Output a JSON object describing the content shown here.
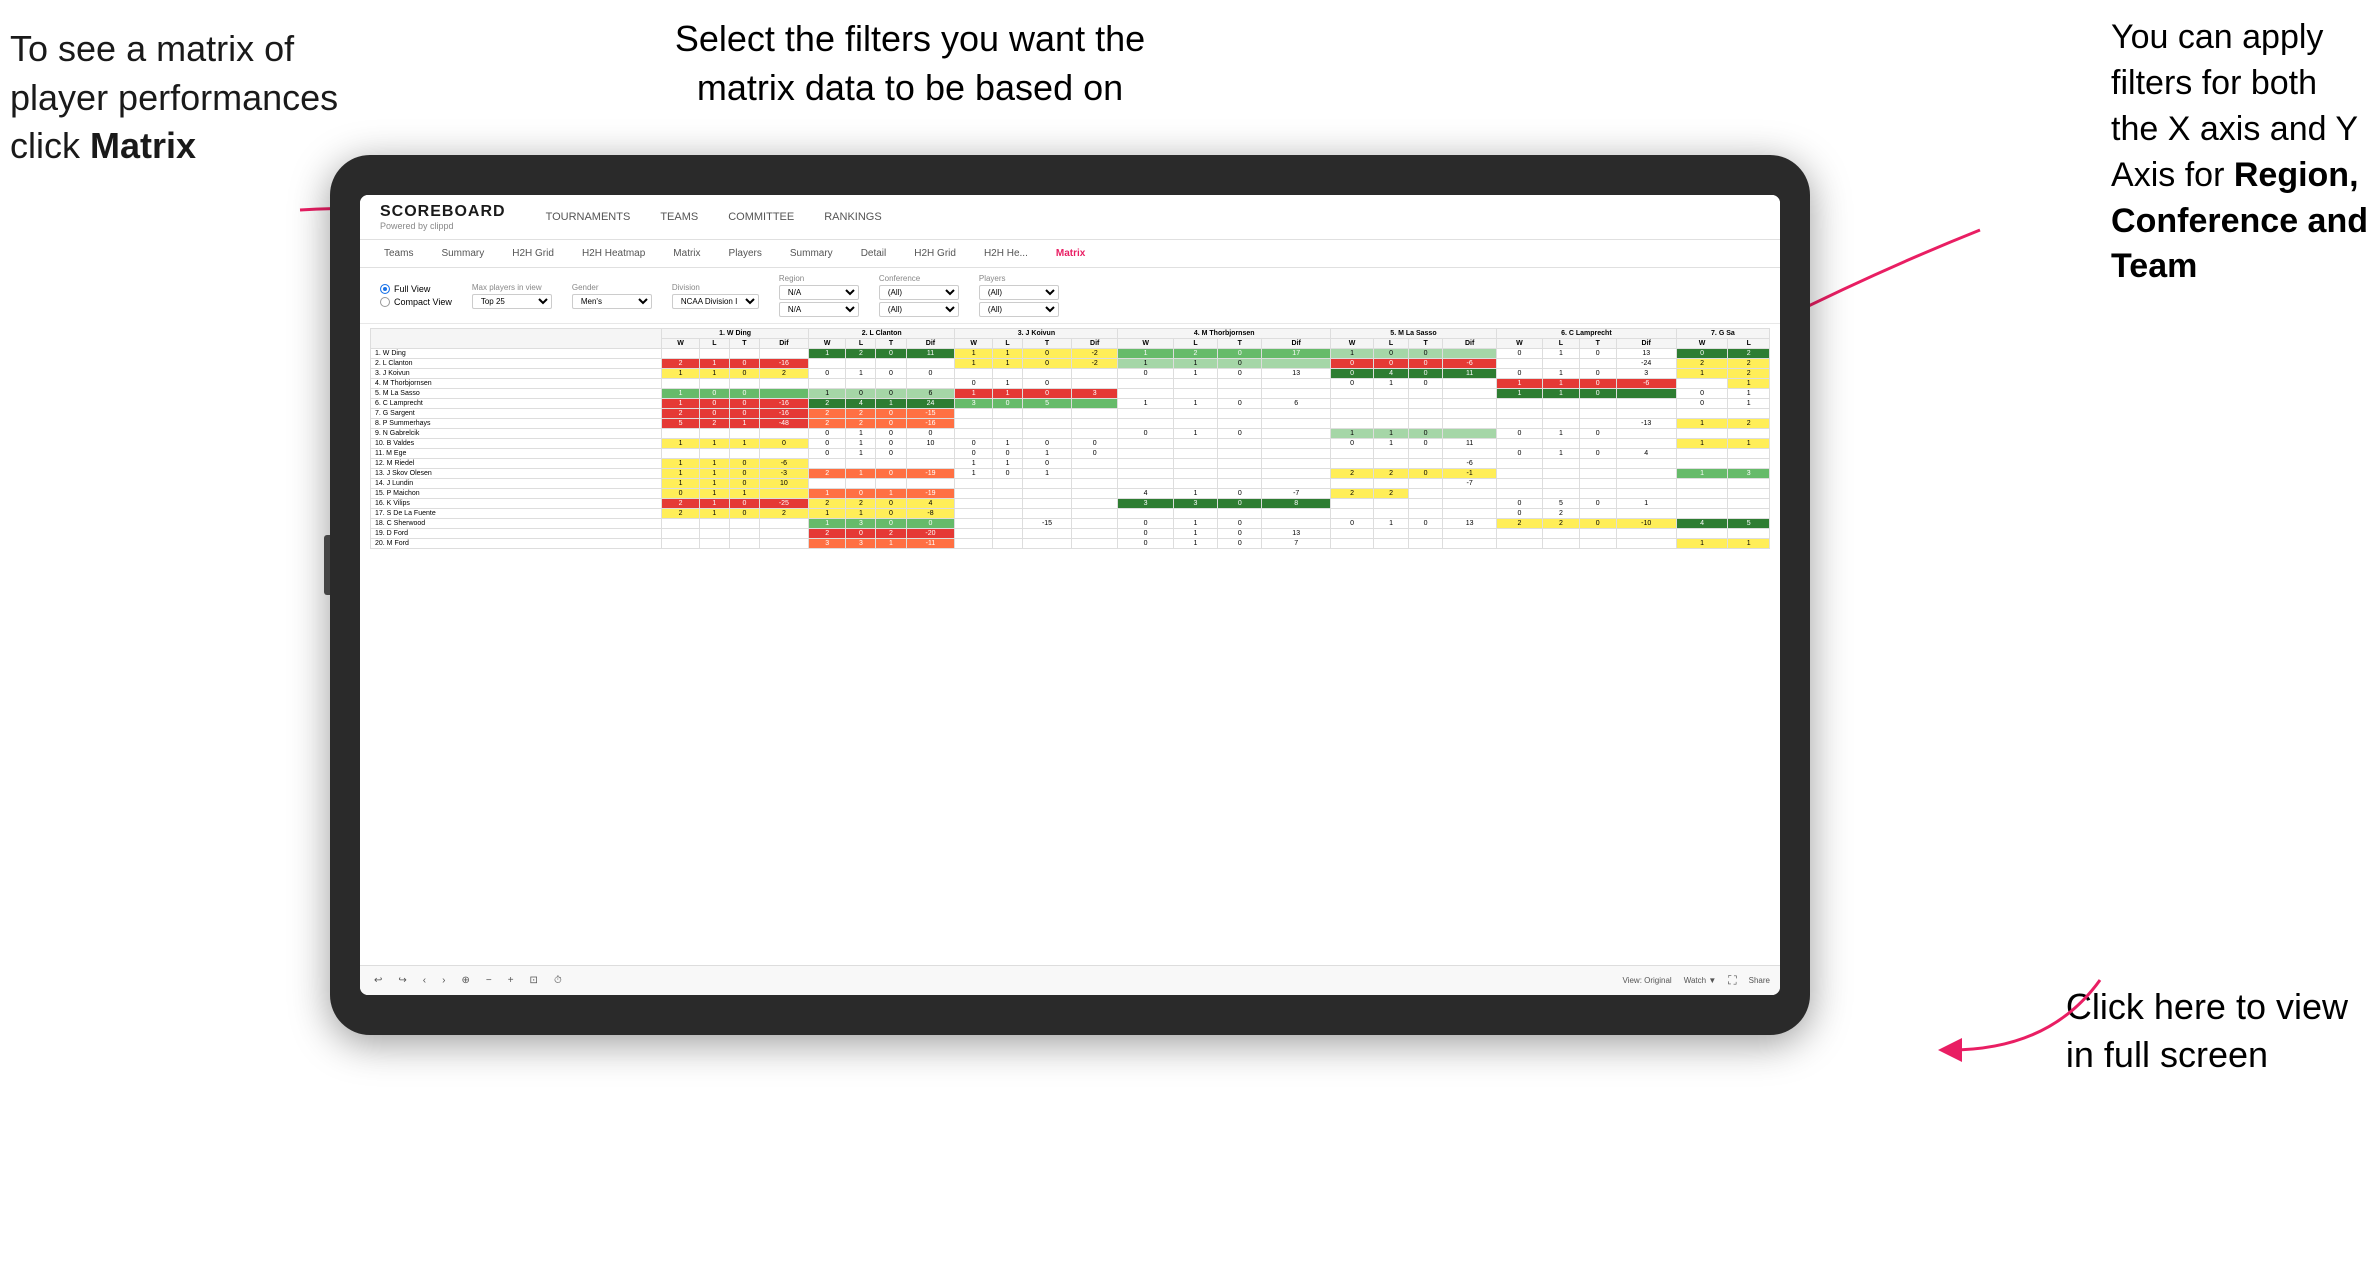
{
  "annotations": {
    "top_left": {
      "line1": "To see a matrix of",
      "line2": "player performances",
      "line3_plain": "click ",
      "line3_bold": "Matrix"
    },
    "top_center": {
      "text": "Select the filters you want the\nmatrix data to be based on"
    },
    "top_right": {
      "line1": "You  can apply",
      "line2": "filters for both",
      "line3": "the X axis and Y",
      "line4_plain": "Axis for ",
      "line4_bold": "Region,",
      "line5_bold": "Conference and",
      "line6_bold": "Team"
    },
    "bottom_right": {
      "line1": "Click here to view",
      "line2": "in full screen"
    }
  },
  "app": {
    "logo": "SCOREBOARD",
    "logo_sub": "Powered by clippd",
    "nav": [
      "TOURNAMENTS",
      "TEAMS",
      "COMMITTEE",
      "RANKINGS"
    ],
    "sub_nav": [
      "Teams",
      "Summary",
      "H2H Grid",
      "H2H Heatmap",
      "Matrix",
      "Players",
      "Summary",
      "Detail",
      "H2H Grid",
      "H2H He...",
      "Matrix"
    ],
    "active_tab": "Matrix",
    "filters": {
      "view_options": [
        "Full View",
        "Compact View"
      ],
      "selected_view": "Full View",
      "max_players_label": "Max players in view",
      "max_players_value": "Top 25",
      "gender_label": "Gender",
      "gender_value": "Men's",
      "division_label": "Division",
      "division_value": "NCAA Division I",
      "region_label": "Region",
      "region_value": "N/A",
      "conference_label": "Conference",
      "conference_value": "(All)",
      "players_label": "Players",
      "players_value": "(All)"
    },
    "matrix": {
      "col_headers": [
        "1. W Ding",
        "2. L Clanton",
        "3. J Koivun",
        "4. M Thorbjornsen",
        "5. M La Sasso",
        "6. C Lamprecht",
        "7. G Sa"
      ],
      "sub_headers": [
        "W",
        "L",
        "T",
        "Dif"
      ],
      "rows": [
        {
          "name": "1. W Ding",
          "cells": [
            "",
            "",
            "",
            "",
            "1",
            "2",
            "0",
            "11",
            "1",
            "1",
            "0",
            "-2",
            "1",
            "2",
            "0",
            "17",
            "1",
            "0",
            "0",
            "",
            "0",
            "1",
            "0",
            "13",
            "0",
            "2"
          ]
        },
        {
          "name": "2. L Clanton",
          "cells": [
            "2",
            "1",
            "0",
            "-16",
            "",
            "",
            "",
            "",
            "1",
            "1",
            "0",
            "-2",
            "1",
            "1",
            "0",
            "",
            "0",
            "0",
            "0",
            "-6",
            "",
            "",
            "",
            "",
            "-24",
            "2",
            "2"
          ]
        },
        {
          "name": "3. J Koivun",
          "cells": [
            "1",
            "1",
            "0",
            "2",
            "0",
            "1",
            "0",
            "0",
            "",
            "",
            "",
            "",
            "0",
            "1",
            "0",
            "13",
            "0",
            "4",
            "0",
            "11",
            "0",
            "1",
            "0",
            "3",
            "1",
            "2"
          ]
        },
        {
          "name": "4. M Thorbjornsen",
          "cells": [
            "",
            "",
            "",
            "",
            "",
            "",
            "",
            "",
            "0",
            "1",
            "0",
            "",
            "",
            "",
            "",
            "",
            "0",
            "1",
            "0",
            "",
            "1",
            "1",
            "0",
            "-6",
            "",
            "",
            "",
            "1"
          ]
        },
        {
          "name": "5. M La Sasso",
          "cells": [
            "1",
            "0",
            "0",
            "",
            "1",
            "0",
            "0",
            "6",
            "1",
            "1",
            "0",
            "3",
            "",
            "",
            "",
            "",
            "1",
            "1",
            "0",
            "",
            "",
            "",
            "",
            "",
            "0",
            "1"
          ]
        },
        {
          "name": "6. C Lamprecht",
          "cells": [
            "1",
            "0",
            "0",
            "-16",
            "2",
            "4",
            "1",
            "24",
            "3",
            "0",
            "5",
            "",
            "1",
            "1",
            "0",
            "6",
            "",
            "",
            "",
            "",
            "",
            "",
            "",
            "",
            "0",
            "1"
          ]
        },
        {
          "name": "7. G Sargent",
          "cells": [
            "2",
            "0",
            "0",
            "-16",
            "2",
            "2",
            "0",
            "-15",
            "",
            "",
            "",
            "",
            "",
            "",
            "",
            "",
            "",
            "",
            "",
            "",
            "",
            "",
            "",
            "",
            "",
            ""
          ]
        },
        {
          "name": "8. P Summerhays",
          "cells": [
            "5",
            "2",
            "1",
            "-48",
            "2",
            "2",
            "0",
            "-16",
            "",
            "",
            "",
            "",
            "",
            "",
            "",
            "",
            "",
            "",
            "",
            "",
            "",
            "",
            "",
            "-13",
            "1",
            "2"
          ]
        },
        {
          "name": "9. N Gabrelcik",
          "cells": [
            "",
            "",
            "",
            "",
            "0",
            "1",
            "0",
            "0",
            "",
            "",
            "",
            "",
            "0",
            "1",
            "0",
            "",
            "1",
            "1",
            "0",
            "",
            "0",
            "1",
            "0",
            "",
            "",
            ""
          ]
        },
        {
          "name": "10. B Valdes",
          "cells": [
            "1",
            "1",
            "1",
            "0",
            "0",
            "1",
            "0",
            "10",
            "0",
            "1",
            "0",
            "0",
            "",
            "",
            "",
            "",
            "0",
            "1",
            "0",
            "11",
            "",
            "",
            "",
            "",
            "1",
            "1"
          ]
        },
        {
          "name": "11. M Ege",
          "cells": [
            "",
            "",
            "",
            "",
            "0",
            "1",
            "0",
            "",
            "0",
            "0",
            "1",
            "0",
            "",
            "",
            "",
            "",
            "",
            "",
            "",
            "",
            "0",
            "1",
            "0",
            "4",
            "",
            ""
          ]
        },
        {
          "name": "12. M Riedel",
          "cells": [
            "1",
            "1",
            "0",
            "-6",
            "",
            "",
            "",
            "",
            "1",
            "1",
            "0",
            "",
            "",
            "",
            "",
            "",
            "",
            "",
            "",
            "",
            "-6",
            "",
            "",
            "",
            "",
            ""
          ]
        },
        {
          "name": "13. J Skov Olesen",
          "cells": [
            "1",
            "1",
            "0",
            "-3",
            "2",
            "1",
            "0",
            "-19",
            "1",
            "0",
            "1",
            "",
            "",
            "",
            "",
            "",
            "2",
            "2",
            "0",
            "-1",
            "",
            "",
            "",
            "",
            "1",
            "3"
          ]
        },
        {
          "name": "14. J Lundin",
          "cells": [
            "1",
            "1",
            "0",
            "10",
            "",
            "",
            "",
            "",
            "",
            "",
            "",
            "",
            "",
            "",
            "",
            "",
            "",
            "",
            "",
            "-7",
            "",
            "",
            "",
            "",
            "",
            ""
          ]
        },
        {
          "name": "15. P Maichon",
          "cells": [
            "0",
            "1",
            "1",
            "",
            "1",
            "0",
            "1",
            "-19",
            "",
            "",
            "",
            "",
            "4",
            "1",
            "0",
            "-7",
            "2",
            "2",
            "",
            "",
            "",
            ""
          ]
        },
        {
          "name": "16. K Vilips",
          "cells": [
            "2",
            "1",
            "0",
            "-25",
            "2",
            "2",
            "0",
            "4",
            "",
            "",
            "",
            "",
            "3",
            "3",
            "0",
            "8",
            "",
            "",
            "",
            "",
            "0",
            "5",
            "0",
            "1"
          ]
        },
        {
          "name": "17. S De La Fuente",
          "cells": [
            "2",
            "1",
            "0",
            "2",
            "1",
            "1",
            "0",
            "-8",
            "",
            "",
            "",
            "",
            "",
            "",
            "",
            "",
            "",
            "",
            "",
            "",
            "0",
            "2"
          ]
        },
        {
          "name": "18. C Sherwood",
          "cells": [
            "",
            "",
            "",
            "",
            "1",
            "3",
            "0",
            "0",
            "",
            "",
            "",
            "-15",
            "0",
            "1",
            "0",
            "",
            "0",
            "1",
            "0",
            "13",
            "2",
            "2",
            "0",
            "-10",
            "4",
            "5"
          ]
        },
        {
          "name": "19. D Ford",
          "cells": [
            "",
            "",
            "",
            "",
            "2",
            "0",
            "2",
            "-20",
            "",
            "",
            "",
            "",
            "0",
            "1",
            "0",
            "13",
            "",
            "",
            "",
            "",
            "",
            "",
            "",
            "",
            "",
            ""
          ]
        },
        {
          "name": "20. M Ford",
          "cells": [
            "",
            "",
            "",
            "",
            "3",
            "3",
            "1",
            "-11",
            "",
            "",
            "",
            "",
            "0",
            "1",
            "0",
            "7",
            "",
            "",
            "",
            "",
            "",
            "",
            "",
            "",
            "1",
            "1"
          ]
        }
      ]
    }
  },
  "toolbar": {
    "buttons": [
      "undo",
      "redo",
      "back",
      "forward",
      "tools",
      "zoom-out",
      "zoom-in",
      "reset",
      "clock"
    ],
    "view_label": "View: Original",
    "watch_label": "Watch ▼",
    "share_label": "Share"
  },
  "colors": {
    "accent_pink": "#e91e63",
    "green_dark": "#2e7d32",
    "green_med": "#66bb6a",
    "yellow": "#ffee58",
    "orange": "#ffa726",
    "red": "#e53935"
  }
}
